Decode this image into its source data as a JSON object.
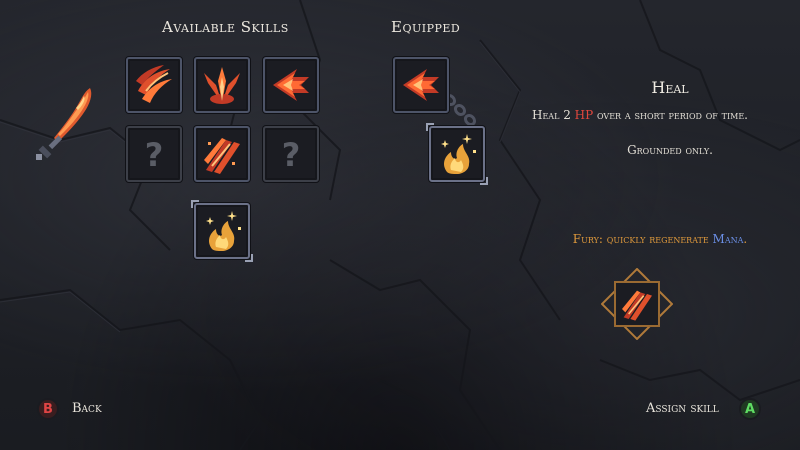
{
  "headings": {
    "available": "Available Skills",
    "equipped": "Equipped"
  },
  "skill_info": {
    "title": "Heal",
    "description_prefix": "Heal 2 ",
    "description_highlight": "HP",
    "description_suffix": " over a short period of time.",
    "note": "Grounded only.",
    "fury_prefix": "Fury: quickly regenerate ",
    "fury_highlight": "Mana",
    "fury_suffix": "."
  },
  "available_skills": [
    {
      "icon": "flame-claw-icon",
      "state": "unlocked"
    },
    {
      "icon": "fire-burst-icon",
      "state": "unlocked"
    },
    {
      "icon": "flame-arrow-icon",
      "state": "unlocked"
    },
    {
      "icon": "unknown-skill-icon",
      "label": "?",
      "state": "locked"
    },
    {
      "icon": "fire-slash-icon",
      "state": "unlocked"
    },
    {
      "icon": "unknown-skill-icon",
      "label": "?",
      "state": "locked"
    },
    {
      "icon": "heal-flame-icon",
      "state": "selected"
    }
  ],
  "equipped_skills": [
    {
      "icon": "flame-arrow-icon"
    },
    {
      "icon": "heal-flame-icon"
    }
  ],
  "weapon": {
    "icon": "flame-sword-icon"
  },
  "fury_skill": {
    "icon": "fire-slash-icon"
  },
  "controls": {
    "back_key": "B",
    "back_label": "Back",
    "assign_key": "A",
    "assign_label": "Assign skill"
  },
  "colors": {
    "hp": "#e2473d",
    "mana": "#6b8fe6",
    "fury": "#e09a3c",
    "slot_border": "#4d5468"
  }
}
